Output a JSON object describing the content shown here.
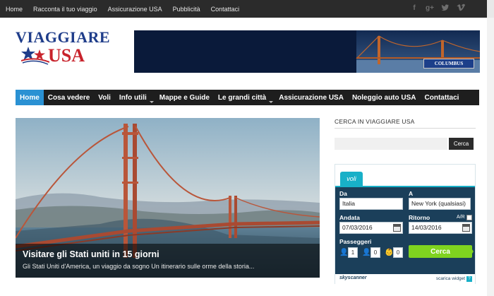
{
  "topbar": {
    "nav": [
      "Home",
      "Racconta il tuo viaggio",
      "Assicurazione USA",
      "Pubblicità",
      "Contattaci"
    ],
    "social_icons": [
      "facebook-icon",
      "google-plus-icon",
      "twitter-icon",
      "vimeo-icon"
    ]
  },
  "logo": {
    "line1": "VIAGGIARE",
    "line2": "USA"
  },
  "banner": {
    "brand": "COLUMBUS"
  },
  "mainnav": {
    "items": [
      {
        "label": "Home",
        "active": true,
        "dropdown": false
      },
      {
        "label": "Cosa vedere",
        "active": false,
        "dropdown": false
      },
      {
        "label": "Voli",
        "active": false,
        "dropdown": false
      },
      {
        "label": "Info utili",
        "active": false,
        "dropdown": true
      },
      {
        "label": "Mappe e Guide",
        "active": false,
        "dropdown": false
      },
      {
        "label": "Le grandi città",
        "active": false,
        "dropdown": true
      },
      {
        "label": "Assicurazione USA",
        "active": false,
        "dropdown": false
      },
      {
        "label": "Noleggio auto USA",
        "active": false,
        "dropdown": false
      },
      {
        "label": "Contattaci",
        "active": false,
        "dropdown": false
      }
    ],
    "active_color": "#2a91d3"
  },
  "hero": {
    "title": "Visitare gli Stati uniti in 15 giorni",
    "subtitle": "Gli Stati Uniti d'America, un viaggio da sogno Un itinerario sulle orme della storia..."
  },
  "search": {
    "title": "CERCA IN VIAGGIARE USA",
    "placeholder": "",
    "button": "Cerca"
  },
  "widget": {
    "tab": "voli",
    "from_label": "Da",
    "from_value": "Italia",
    "to_label": "A",
    "to_value": "New York (qualsiasi)",
    "depart_label": "Andata",
    "depart_value": "07/03/2016",
    "return_label": "Ritorno",
    "return_value": "14/03/2016",
    "ar_label": "A/R",
    "pax_label": "Passeggeri",
    "adults": "1",
    "children": "0",
    "infants": "0",
    "cerca": "Cerca",
    "footer_brand": "skyscanner",
    "footer_link": "scarica widget",
    "accent": "#18b0c8",
    "panel_color": "#1b3f5a",
    "button_color": "#7fd31f"
  }
}
